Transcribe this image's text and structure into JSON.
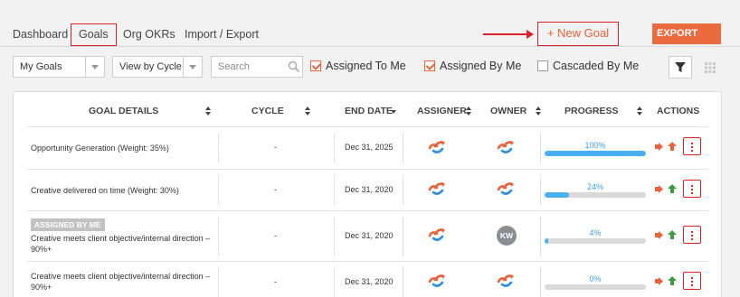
{
  "tabs": [
    "Dashboard",
    "Goals",
    "Org OKRs",
    "Import / Export"
  ],
  "new_goal_label": "+ New Goal",
  "export_label": "EXPORT",
  "filters": {
    "my_goals": "My Goals",
    "view_by": "View by Cycle",
    "search_placeholder": "Search",
    "assigned_to_me": "Assigned To Me",
    "assigned_by_me": "Assigned By Me",
    "cascaded_by_me": "Cascaded By Me"
  },
  "columns": {
    "goal_details": "GOAL DETAILS",
    "cycle": "CYCLE",
    "end_date": "END DATE",
    "assigner": "ASSIGNER",
    "owner": "OWNER",
    "progress": "PROGRESS",
    "actions": "ACTIONS"
  },
  "colors": {
    "accent": "#e8623c",
    "highlight": "#d9222a",
    "progress": "#48b0ee",
    "progress_text": "#3aa0e8",
    "up_orange": "#e8623c",
    "up_green": "#3d9b3d"
  },
  "rows": [
    {
      "goal": "Opportunity Generation (Weight: 35%)",
      "cycle": "-",
      "end_date": "Dec 31, 2025",
      "progress_label": "100%",
      "progress_value": 1.0,
      "owner_initials": ""
    },
    {
      "goal": "Creative delivered on time (Weight: 30%)",
      "cycle": "-",
      "end_date": "Dec 31, 2020",
      "progress_label": "24%",
      "progress_value": 0.24,
      "owner_initials": ""
    },
    {
      "badge": "ASSIGNED BY ME",
      "goal": "Creative meets client objective/internal direction – 90%+",
      "cycle": "-",
      "end_date": "Dec 31, 2020",
      "progress_label": "4%",
      "progress_value": 0.04,
      "owner_initials": "KW"
    },
    {
      "goal": "Creative meets client objective/internal direction – 90%+",
      "cycle": "-",
      "end_date": "Dec 31, 2020",
      "progress_label": "0%",
      "progress_value": 0.0,
      "owner_initials": ""
    }
  ]
}
